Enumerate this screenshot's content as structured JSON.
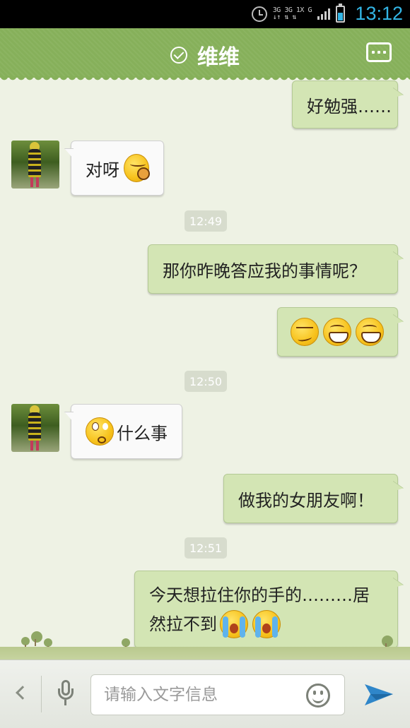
{
  "status_bar": {
    "time": "13:12",
    "net_top": "3G 3G 1X G",
    "net_bottom": "↓↑ ⇅ ⇅",
    "icons": [
      "alarm-clock-icon",
      "signal-icon",
      "battery-icon"
    ]
  },
  "header": {
    "title": "维维",
    "status_icon": "check-circle-icon",
    "menu_icon": "more-icon"
  },
  "messages": [
    {
      "from": "me",
      "text": "好勉强……",
      "emojis": []
    },
    {
      "from": "them",
      "text": "对呀",
      "emojis": [
        "yawn"
      ]
    },
    {
      "type": "time",
      "text": "12:49"
    },
    {
      "from": "me",
      "text": "那你昨晚答应我的事情呢？",
      "emojis": []
    },
    {
      "from": "me",
      "text": "",
      "emojis": [
        "smirk",
        "grin",
        "grin"
      ]
    },
    {
      "type": "time",
      "text": "12:50"
    },
    {
      "from": "them",
      "text": "什么事",
      "emojis": [
        "eyeroll"
      ]
    },
    {
      "from": "me",
      "text": "做我的女朋友啊！",
      "emojis": []
    },
    {
      "type": "time",
      "text": "12:51"
    },
    {
      "from": "me",
      "text_line1": "今天想拉住你的手的………居",
      "text_line2": "然拉不到",
      "emojis": [
        "cry",
        "cry"
      ]
    }
  ],
  "input_bar": {
    "placeholder": "请输入文字信息",
    "value": "",
    "icons": [
      "back-chevron-icon",
      "microphone-icon",
      "smiley-icon",
      "send-icon"
    ]
  },
  "colors": {
    "title_bar": "#86b05a",
    "my_bubble": "#d3e5b4",
    "their_bubble": "#fafafa",
    "chat_bg": "#eef2e4",
    "accent": "#33b5e5"
  }
}
